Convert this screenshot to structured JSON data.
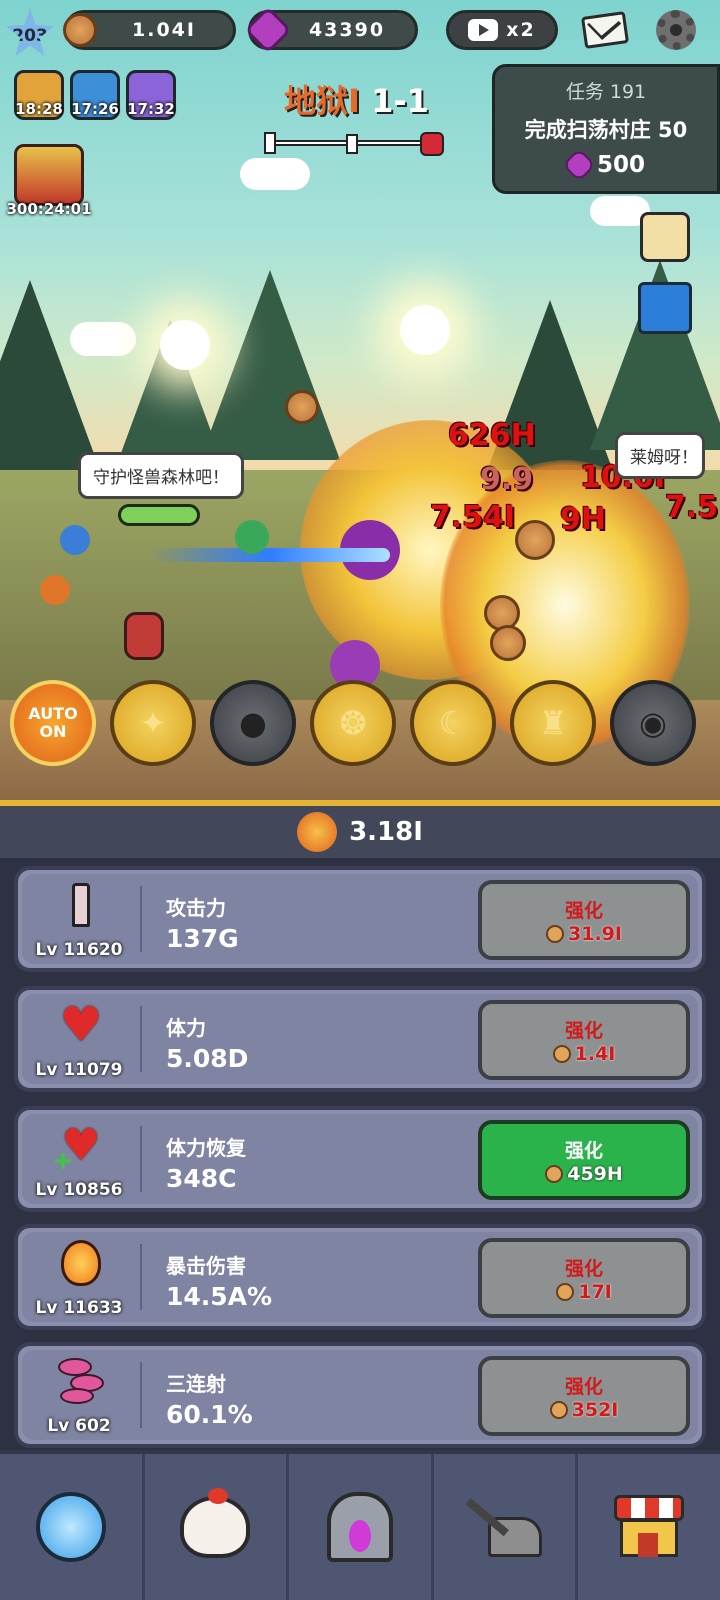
{
  "hud": {
    "level": "203",
    "coins": "1.04I",
    "gems": "43390",
    "ad_multiplier": "x2"
  },
  "buffs": [
    {
      "icon": "coin-stack-icon",
      "time": "18:28"
    },
    {
      "icon": "sword-icon",
      "time": "17:26"
    },
    {
      "icon": "lightning-icon",
      "time": "17:32"
    }
  ],
  "chest": {
    "icon": "mushroom-chest-icon",
    "time": "300:24:01"
  },
  "stage": {
    "name": "地狱I",
    "number": "1-1"
  },
  "quest": {
    "title": "任务 191",
    "desc": "完成扫荡村庄 50",
    "reward": "500"
  },
  "battle": {
    "speech_left": "守护怪兽森林吧！",
    "speech_right": "莱姆呀！",
    "damage": [
      "626H",
      "7.54I",
      "9.9",
      "10.0I",
      "7.5",
      "9H"
    ]
  },
  "skills": {
    "auto": "AUTO",
    "auto_state": "ON"
  },
  "power": "3.18I",
  "upgrades": [
    {
      "icon": "sword-icon",
      "level": "Lv 11620",
      "name": "攻击力",
      "value": "137G",
      "button": "强化",
      "cost": "31.9I",
      "affordable": false
    },
    {
      "icon": "heart-icon",
      "level": "Lv 11079",
      "name": "体力",
      "value": "5.08D",
      "button": "强化",
      "cost": "1.4I",
      "affordable": false
    },
    {
      "icon": "heart-plus-icon",
      "level": "Lv 10856",
      "name": "体力恢复",
      "value": "348C",
      "button": "强化",
      "cost": "459H",
      "affordable": true
    },
    {
      "icon": "flame-sword-icon",
      "level": "Lv 11633",
      "name": "暴击伤害",
      "value": "14.5A%",
      "button": "强化",
      "cost": "17I",
      "affordable": false
    },
    {
      "icon": "triple-shot-icon",
      "level": "Lv 602",
      "name": "三连射",
      "value": "60.1%",
      "button": "强化",
      "cost": "352I",
      "affordable": false
    }
  ],
  "colors": {
    "accent_gold": "#e4b532",
    "button_green": "#2ab24b",
    "cost_red": "#d31919"
  }
}
